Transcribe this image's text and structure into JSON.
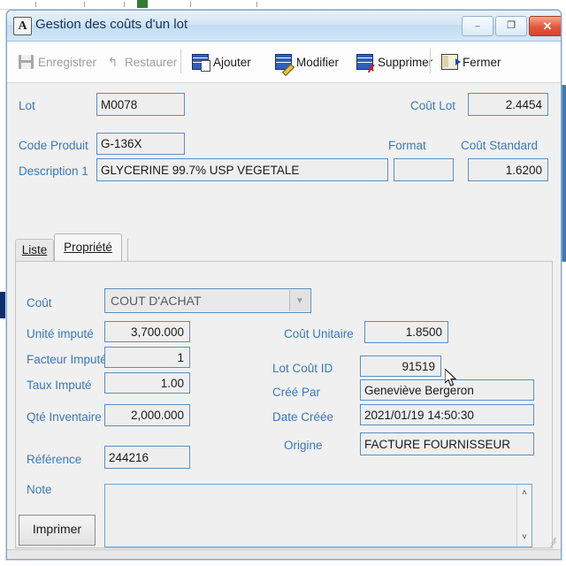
{
  "window": {
    "title": "Gestion des coûts d'un lot",
    "app_icon": "A",
    "controls": {
      "minimize": "–",
      "maximize": "❐",
      "close": "✕"
    }
  },
  "toolbar": {
    "items": [
      {
        "label": "Enregistrer",
        "icon": "save-icon",
        "enabled": false
      },
      {
        "label": "Restaurer",
        "icon": "undo-icon",
        "enabled": false
      },
      {
        "label": "Ajouter",
        "icon": "add-record-icon",
        "enabled": true
      },
      {
        "label": "Modifier",
        "icon": "edit-record-icon",
        "enabled": true
      },
      {
        "label": "Supprimer",
        "icon": "delete-record-icon",
        "enabled": true
      },
      {
        "label": "Fermer",
        "icon": "exit-door-icon",
        "enabled": true
      }
    ]
  },
  "header": {
    "lot_label": "Lot",
    "lot_value": "M0078",
    "cout_lot_label": "Coût Lot",
    "cout_lot_value": "2.4454",
    "code_produit_label": "Code Produit",
    "code_produit_value": "G-136X",
    "format_label": "Format",
    "format_value": "",
    "cout_standard_label": "Coût Standard",
    "cout_standard_value": "1.6200",
    "description_label": "Description 1",
    "description_value": "GLYCERINE 99.7% USP VEGETALE"
  },
  "tabs": [
    {
      "label": "Liste",
      "active": false
    },
    {
      "label": "Propriété",
      "active": true
    }
  ],
  "properties": {
    "cout_label": "Coût",
    "cout_value": "COUT D'ACHAT",
    "unite_impute_label": "Unité imputé",
    "unite_impute_value": "3,700.000",
    "facteur_impute_label": "Facteur Imputé",
    "facteur_impute_value": "1",
    "taux_impute_label": "Taux Imputé",
    "taux_impute_value": "1.00",
    "qte_inventaire_label": "Qté Inventaire",
    "qte_inventaire_value": "2,000.000",
    "reference_label": "Référence",
    "reference_value": "244216",
    "cout_unitaire_label": "Coût Unitaire",
    "cout_unitaire_value": "1.8500",
    "lot_cout_id_label": "Lot Coût ID",
    "lot_cout_id_value": "91519",
    "cree_par_label": "Créé Par",
    "cree_par_value": "Geneviève Bergeron",
    "date_creee_label": "Date Créée",
    "date_creee_value": "2021/01/19 14:50:30",
    "origine_label": "Origine",
    "origine_value": "FACTURE FOURNISSEUR",
    "note_label": "Note",
    "note_value": "",
    "imprimer_label": "Imprimer",
    "scroll_up": "˄",
    "scroll_down": "˅",
    "dropdown_arrow": "▼"
  },
  "colors": {
    "label_blue": "#3a79b8",
    "field_border": "#5b8fbf",
    "titlebar_blue": "#c3dcf2",
    "close_red": "#e2563a",
    "icon_blue": "#2f5fbe",
    "delete_red": "#d01d1d"
  }
}
